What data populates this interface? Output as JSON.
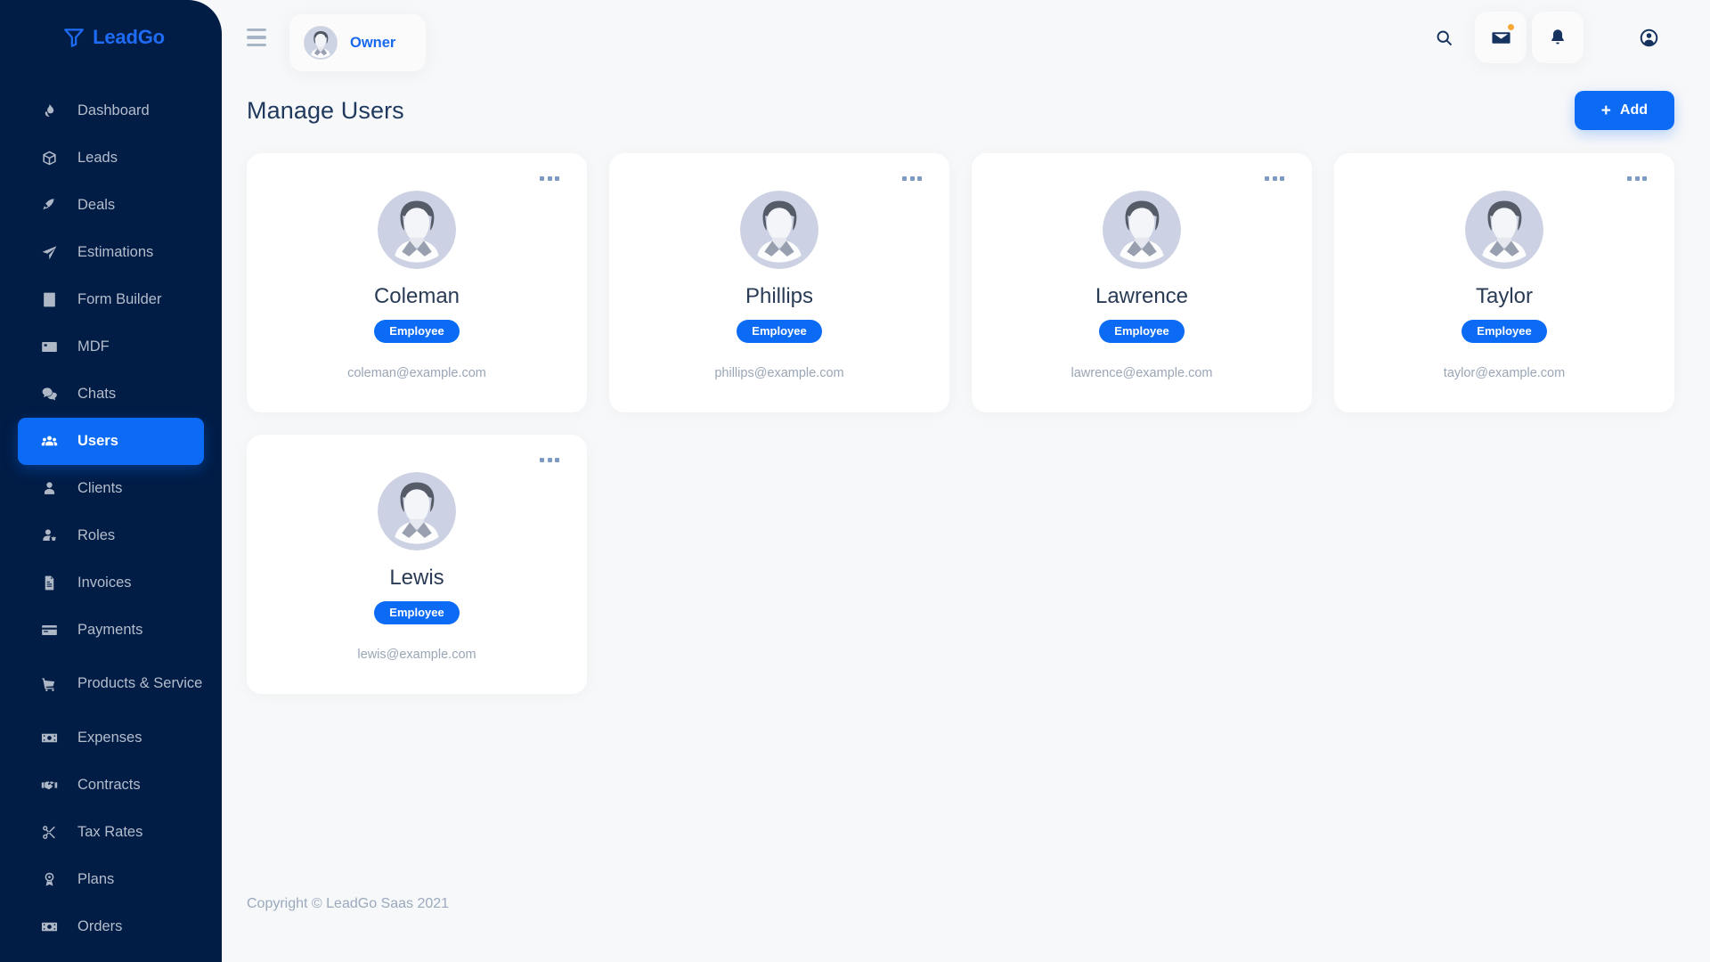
{
  "brand": {
    "name": "LeadGo",
    "icon": "funnel-icon",
    "color": "#1e6cf5"
  },
  "sidebar": {
    "items": [
      {
        "label": "Dashboard",
        "icon": "flame-icon",
        "active": false
      },
      {
        "label": "Leads",
        "icon": "box-icon",
        "active": false
      },
      {
        "label": "Deals",
        "icon": "rocket-icon",
        "active": false
      },
      {
        "label": "Estimations",
        "icon": "paper-plane-icon",
        "active": false
      },
      {
        "label": "Form Builder",
        "icon": "form-icon",
        "active": false
      },
      {
        "label": "MDF",
        "icon": "card-icon",
        "active": false
      },
      {
        "label": "Chats",
        "icon": "chat-icon",
        "active": false
      },
      {
        "label": "Users",
        "icon": "users-icon",
        "active": true
      },
      {
        "label": "Clients",
        "icon": "user-icon",
        "active": false
      },
      {
        "label": "Roles",
        "icon": "user-gear-icon",
        "active": false
      },
      {
        "label": "Invoices",
        "icon": "invoice-icon",
        "active": false
      },
      {
        "label": "Payments",
        "icon": "credit-card-icon",
        "active": false
      },
      {
        "label": "Products & Service",
        "icon": "cart-icon",
        "active": false
      },
      {
        "label": "Expenses",
        "icon": "money-icon",
        "active": false
      },
      {
        "label": "Contracts",
        "icon": "handshake-icon",
        "active": false
      },
      {
        "label": "Tax Rates",
        "icon": "scissors-icon",
        "active": false
      },
      {
        "label": "Plans",
        "icon": "medal-icon",
        "active": false
      },
      {
        "label": "Orders",
        "icon": "money-icon",
        "active": false
      }
    ]
  },
  "topbar": {
    "menu_icon": "hamburger-icon",
    "owner": {
      "label": "Owner",
      "avatar": "user-avatar"
    },
    "actions": [
      {
        "name": "search-icon",
        "badge": false
      },
      {
        "name": "mail-icon",
        "badge": true
      },
      {
        "name": "bell-icon",
        "badge": false
      },
      {
        "name": "globe-user-icon",
        "badge": false
      }
    ]
  },
  "page": {
    "title": "Manage Users",
    "add_button": {
      "label": "Add",
      "icon": "plus-icon"
    }
  },
  "users": [
    {
      "name": "Coleman",
      "role": "Employee",
      "email": "coleman@example.com"
    },
    {
      "name": "Phillips",
      "role": "Employee",
      "email": "phillips@example.com"
    },
    {
      "name": "Lawrence",
      "role": "Employee",
      "email": "lawrence@example.com"
    },
    {
      "name": "Taylor",
      "role": "Employee",
      "email": "taylor@example.com"
    },
    {
      "name": "Lewis",
      "role": "Employee",
      "email": "lewis@example.com"
    }
  ],
  "card_menu_icon": "more-options-icon",
  "footer": {
    "text": "Copyright © LeadGo Saas 2021"
  },
  "colors": {
    "sidebar_bg": "#011c45",
    "accent": "#0c6bf5",
    "page_bg": "#f7f8f9",
    "card_bg": "#ffffff",
    "badge_orange": "#f7a937"
  }
}
